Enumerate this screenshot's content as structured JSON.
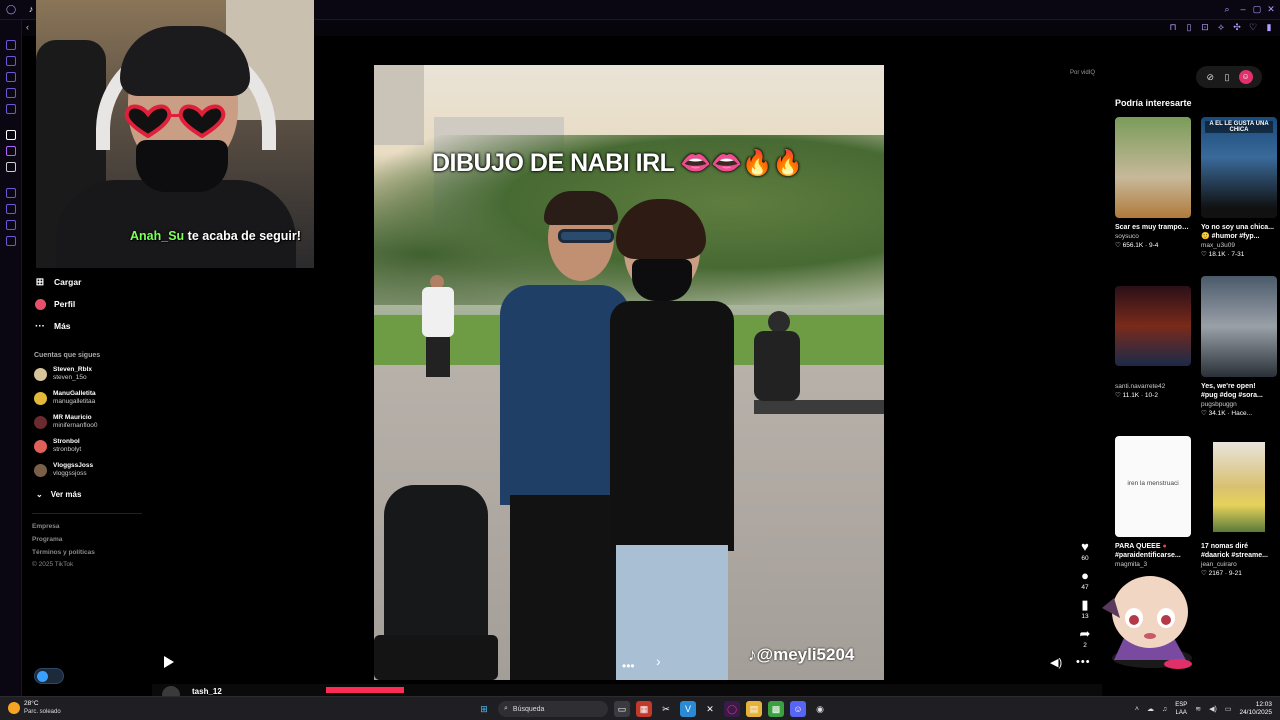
{
  "webcam": {
    "follow_user": "Anah_Su",
    "follow_text": " te acaba de seguir!"
  },
  "sidebar": {
    "nav": [
      {
        "label": "Cargar",
        "icon": "plus-square-icon"
      },
      {
        "label": "Perfil",
        "icon": "profile-avatar-icon"
      },
      {
        "label": "Más",
        "icon": "more-dots-icon"
      }
    ],
    "following_title": "Cuentas que sigues",
    "accounts": [
      {
        "name": "Steven_Rblx",
        "username": "steven_15o"
      },
      {
        "name": "ManuGalletita",
        "username": "manugalletitaa"
      },
      {
        "name": "MR Mauricio",
        "username": "minifernanfloo0"
      },
      {
        "name": "Stronbol",
        "username": "stronbolyt"
      },
      {
        "name": "VloggssJoss",
        "username": "vloggssjoss"
      }
    ],
    "see_more": "Ver más",
    "footer": [
      "Empresa",
      "Programa",
      "Términos y políticas",
      "© 2025 TikTok"
    ]
  },
  "video": {
    "caption": "DIBUJO DE NABI IRL",
    "caption_emojis": "👄👄🔥🔥",
    "watermark": "@meyli5204"
  },
  "por_label": "Por vidIQ",
  "actions": {
    "likes": "60",
    "comments": "47",
    "saves": "13",
    "shares": "2"
  },
  "recommendations": {
    "title": "Podría interesarte",
    "items": [
      {
        "title": "Scar es muy tramposa jugando...",
        "author": "soysuco",
        "stats": "656.1K · 9-4",
        "thumb_text": ""
      },
      {
        "title": "Yo no soy una chica...",
        "author": "max_u3u09",
        "stats": "18.1K · 7-31",
        "thumb_text": "A EL LE GUSTA UNA CHICA"
      },
      {
        "title": "",
        "author": "santi.navarrete42",
        "stats": "11.1K · 10-2",
        "thumb_text": ""
      },
      {
        "title": "Yes, we're open!",
        "author": "pugsbpuggn",
        "stats": "34.1K · Hace...",
        "thumb_text": ""
      },
      {
        "title": "PARA QUEEE",
        "author": "magmita_3",
        "stats": "",
        "thumb_text": "iren la menstruaci"
      },
      {
        "title": "17 nomas diré",
        "author": "jean_cuiraro",
        "stats": "2167 · 9-21",
        "thumb_text": ""
      }
    ],
    "subtitles": [
      "",
      "🙂 #humor #fyp...",
      "",
      "#pug #dog #sora...",
      "#paraidentificarse...",
      "#daarick #streame..."
    ]
  },
  "bottom": {
    "name": "tash_12"
  },
  "taskbar": {
    "temp": "28°C",
    "weather": "Parc. soleado",
    "search": "Búsqueda",
    "lang1": "ESP",
    "lang2": "LAA",
    "time": "12:03",
    "date": "24/10/2025"
  },
  "colors": {
    "accent": "#fe2c55",
    "follow_name": "#7dff5c",
    "browser_accent": "#b89cff"
  }
}
